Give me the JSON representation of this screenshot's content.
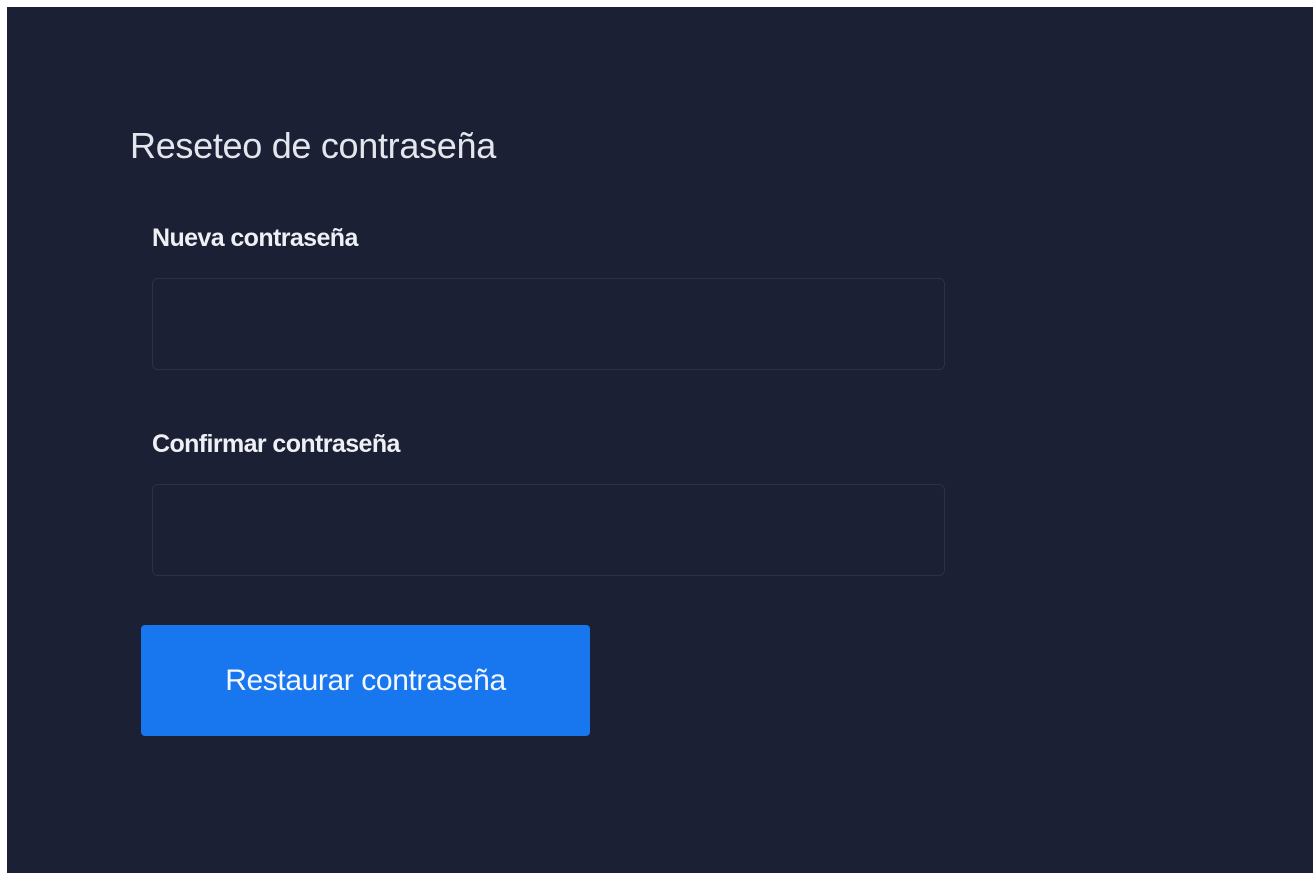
{
  "form": {
    "title": "Reseteo de contraseña",
    "new_password": {
      "label": "Nueva contraseña",
      "value": "",
      "placeholder": ""
    },
    "confirm_password": {
      "label": "Confirmar contraseña",
      "value": "",
      "placeholder": ""
    },
    "submit_label": "Restaurar contraseña"
  },
  "colors": {
    "background": "#1b2034",
    "input_border": "#2c3246",
    "button": "#1877ee",
    "text": "#e4e6ed"
  }
}
